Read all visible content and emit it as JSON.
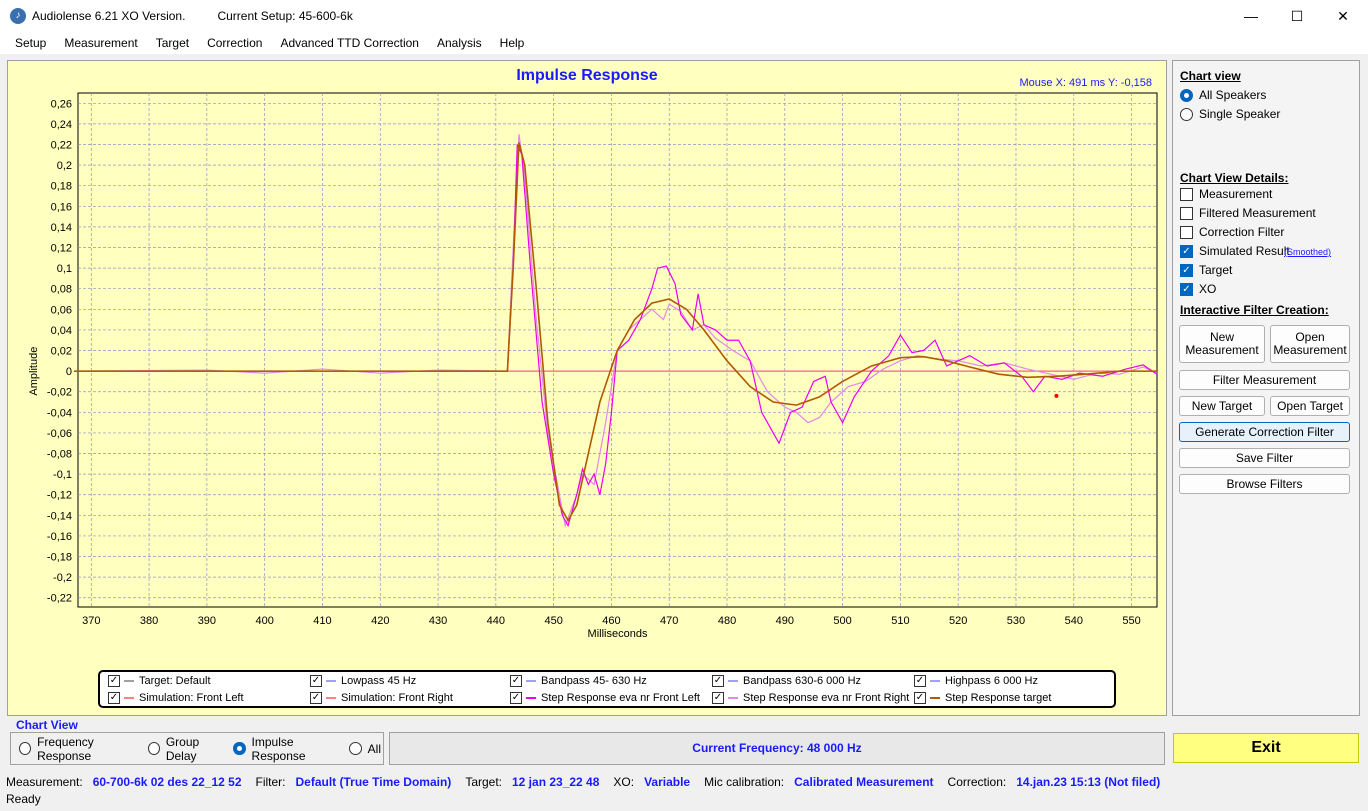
{
  "window": {
    "title": "Audiolense 6.21 XO Version.",
    "setup": "Current Setup: 45-600-6k",
    "min": "—",
    "max": "☐",
    "close": "✕"
  },
  "menu": [
    "Setup",
    "Measurement",
    "Target",
    "Correction",
    "Advanced TTD Correction",
    "Analysis",
    "Help"
  ],
  "chart": {
    "title": "Impulse Response",
    "mouse": "Mouse X: 491 ms   Y: -0,158"
  },
  "chart_data": {
    "type": "line",
    "title": "Impulse Response",
    "xlabel": "Milliseconds",
    "ylabel": "Amplitude",
    "xlim": [
      367.7,
      554.4
    ],
    "ylim": [
      -0.229,
      0.27
    ],
    "xticks": [
      370,
      380,
      390,
      400,
      410,
      420,
      430,
      440,
      450,
      460,
      470,
      480,
      490,
      500,
      510,
      520,
      530,
      540,
      550
    ],
    "yticks": [
      0.26,
      0.24,
      0.22,
      0.2,
      0.18,
      0.16,
      0.14,
      0.12,
      0.1,
      0.08,
      0.06,
      0.04,
      0.02,
      0,
      -0.02,
      -0.04,
      -0.06,
      -0.08,
      -0.1,
      -0.12,
      -0.14,
      -0.16,
      -0.18,
      -0.2,
      -0.22
    ],
    "ytick_labels": [
      "0,26",
      "0,24",
      "0,22",
      "0,2",
      "0,18",
      "0,16",
      "0,14",
      "0,12",
      "0,1",
      "0,08",
      "0,06",
      "0,04",
      "0,02",
      "0",
      "-0,02",
      "-0,04",
      "-0,06",
      "-0,08",
      "-0,1",
      "-0,12",
      "-0,14",
      "-0,16",
      "-0,18",
      "-0,2",
      "-0,22"
    ],
    "grid": true,
    "series": [
      {
        "name": "Step Response eva nr Front Right",
        "color": "#e08ae8",
        "points": [
          [
            367,
            0
          ],
          [
            390,
            0.001
          ],
          [
            400,
            -0.002
          ],
          [
            410,
            0.002
          ],
          [
            420,
            -0.002
          ],
          [
            430,
            0.001
          ],
          [
            442,
            0
          ],
          [
            443,
            0.12
          ],
          [
            444,
            0.23
          ],
          [
            445,
            0.19
          ],
          [
            447,
            0.05
          ],
          [
            449,
            -0.06
          ],
          [
            451,
            -0.12
          ],
          [
            452,
            -0.15
          ],
          [
            454,
            -0.12
          ],
          [
            455,
            -0.1
          ],
          [
            457,
            -0.11
          ],
          [
            459,
            -0.05
          ],
          [
            461,
            0.02
          ],
          [
            463,
            0.04
          ],
          [
            465,
            0.05
          ],
          [
            467,
            0.06
          ],
          [
            469,
            0.05
          ],
          [
            470,
            0.065
          ],
          [
            472,
            0.058
          ],
          [
            474,
            0.04
          ],
          [
            476,
            0.045
          ],
          [
            478,
            0.032
          ],
          [
            481,
            0.02
          ],
          [
            484,
            0.01
          ],
          [
            487,
            -0.02
          ],
          [
            490,
            -0.035
          ],
          [
            492,
            -0.04
          ],
          [
            494,
            -0.05
          ],
          [
            496,
            -0.045
          ],
          [
            498,
            -0.03
          ],
          [
            501,
            -0.015
          ],
          [
            504,
            -0.01
          ],
          [
            507,
            0.002
          ],
          [
            510,
            0.01
          ],
          [
            513,
            0.015
          ],
          [
            516,
            0.012
          ],
          [
            520,
            0.01
          ],
          [
            524,
            0.005
          ],
          [
            528,
            0.008
          ],
          [
            532,
            0.002
          ],
          [
            536,
            -0.003
          ],
          [
            540,
            -0.008
          ],
          [
            544,
            -0.002
          ],
          [
            548,
            -0.003
          ],
          [
            552,
            0.004
          ],
          [
            554.4,
            -0.002
          ]
        ]
      },
      {
        "name": "Step Response eva nr Front Left",
        "color": "#ee00ee",
        "points": [
          [
            367,
            0
          ],
          [
            442,
            0
          ],
          [
            443,
            0.1
          ],
          [
            443.7,
            0.22
          ],
          [
            444.5,
            0.21
          ],
          [
            446,
            0.1
          ],
          [
            448,
            -0.03
          ],
          [
            450,
            -0.1
          ],
          [
            451.5,
            -0.14
          ],
          [
            452.5,
            -0.15
          ],
          [
            454,
            -0.12
          ],
          [
            455,
            -0.095
          ],
          [
            456,
            -0.11
          ],
          [
            457,
            -0.1
          ],
          [
            458,
            -0.12
          ],
          [
            459,
            -0.09
          ],
          [
            460,
            -0.04
          ],
          [
            461,
            0.02
          ],
          [
            463,
            0.03
          ],
          [
            465,
            0.05
          ],
          [
            467,
            0.08
          ],
          [
            468,
            0.1
          ],
          [
            469.5,
            0.102
          ],
          [
            471,
            0.085
          ],
          [
            472,
            0.055
          ],
          [
            474,
            0.04
          ],
          [
            475,
            0.075
          ],
          [
            476,
            0.045
          ],
          [
            478,
            0.04
          ],
          [
            480,
            0.03
          ],
          [
            482,
            0.03
          ],
          [
            484,
            0.01
          ],
          [
            486,
            -0.04
          ],
          [
            488,
            -0.06
          ],
          [
            489,
            -0.07
          ],
          [
            491,
            -0.04
          ],
          [
            493,
            -0.035
          ],
          [
            495,
            -0.01
          ],
          [
            497,
            -0.005
          ],
          [
            498,
            -0.03
          ],
          [
            500,
            -0.05
          ],
          [
            502,
            -0.025
          ],
          [
            505,
            0.0
          ],
          [
            508,
            0.015
          ],
          [
            510,
            0.035
          ],
          [
            512,
            0.018
          ],
          [
            514,
            0.02
          ],
          [
            516,
            0.03
          ],
          [
            518,
            0.005
          ],
          [
            520,
            0.01
          ],
          [
            522,
            0.015
          ],
          [
            525,
            0.005
          ],
          [
            528,
            0.008
          ],
          [
            531,
            -0.005
          ],
          [
            533,
            -0.02
          ],
          [
            535,
            -0.005
          ],
          [
            538,
            -0.008
          ],
          [
            541,
            -0.002
          ],
          [
            545,
            -0.005
          ],
          [
            549,
            0.002
          ],
          [
            552,
            0.006
          ],
          [
            554.4,
            -0.003
          ]
        ]
      },
      {
        "name": "Step Response target",
        "color": "#b05a00",
        "points": [
          [
            367,
            0
          ],
          [
            442,
            0
          ],
          [
            443,
            0.1
          ],
          [
            444,
            0.222
          ],
          [
            445,
            0.2
          ],
          [
            447,
            0.08
          ],
          [
            449,
            -0.05
          ],
          [
            451,
            -0.13
          ],
          [
            452.5,
            -0.145
          ],
          [
            454,
            -0.13
          ],
          [
            456,
            -0.08
          ],
          [
            458,
            -0.03
          ],
          [
            461,
            0.02
          ],
          [
            464,
            0.05
          ],
          [
            467,
            0.066
          ],
          [
            470,
            0.07
          ],
          [
            473,
            0.06
          ],
          [
            476,
            0.04
          ],
          [
            480,
            0.01
          ],
          [
            484,
            -0.015
          ],
          [
            488,
            -0.03
          ],
          [
            492,
            -0.033
          ],
          [
            496,
            -0.025
          ],
          [
            500,
            -0.01
          ],
          [
            505,
            0.005
          ],
          [
            510,
            0.013
          ],
          [
            514,
            0.014
          ],
          [
            518,
            0.01
          ],
          [
            522,
            0.004
          ],
          [
            527,
            -0.003
          ],
          [
            532,
            -0.006
          ],
          [
            537,
            -0.005
          ],
          [
            542,
            -0.003
          ],
          [
            548,
            0
          ],
          [
            554.4,
            0
          ]
        ]
      }
    ],
    "zero_line_color": "#ff6080",
    "marker": {
      "x": 537,
      "y": -0.024,
      "color": "#ff0000"
    }
  },
  "legend": [
    {
      "label": "Target: Default",
      "color": "#a0a0a0"
    },
    {
      "label": "Lowpass  45 Hz",
      "color": "#a0a0ff"
    },
    {
      "label": "Bandpass   45- 630 Hz",
      "color": "#a0a0ff"
    },
    {
      "label": "Bandpass   630-6 000 Hz",
      "color": "#a0a0ff"
    },
    {
      "label": "Highpass  6 000 Hz",
      "color": "#a0a0ff"
    },
    {
      "label": "Simulation: Front Left",
      "color": "#ff8080"
    },
    {
      "label": "Simulation: Front Right",
      "color": "#ff8080"
    },
    {
      "label": "Step Response eva nr Front Left",
      "color": "#ee00ee"
    },
    {
      "label": "Step Response eva nr Front Right",
      "color": "#e08ae8"
    },
    {
      "label": "Step Response target",
      "color": "#b05a00"
    }
  ],
  "side": {
    "chart_view": "Chart view",
    "all": "All Speakers",
    "single": "Single Speaker",
    "details": "Chart View Details:",
    "checks": [
      {
        "label": "Measurement",
        "on": false
      },
      {
        "label": "Filtered Measurement",
        "on": false
      },
      {
        "label": "Correction Filter",
        "on": false
      },
      {
        "label": "Simulated Result",
        "on": true
      },
      {
        "label": "Target",
        "on": true
      },
      {
        "label": "XO",
        "on": true
      }
    ],
    "smoothed": "(Smoothed)",
    "ifc": "Interactive Filter Creation:",
    "new_meas": "New Measurement",
    "open_meas": "Open Measurement",
    "filter_meas": "Filter Measurement",
    "new_target": "New Target",
    "open_target": "Open Target",
    "gen": "Generate Correction Filter",
    "save": "Save Filter",
    "browse": "Browse Filters"
  },
  "bottom": {
    "chart_view": "Chart View",
    "opts": [
      "Frequency Response",
      "Group Delay",
      "Impulse Response",
      "All"
    ],
    "selected": 2,
    "freq": "Current Frequency: 48 000 Hz",
    "exit": "Exit"
  },
  "status": [
    {
      "k": "Measurement:",
      "v": "60-700-6k 02 des 22_12 52"
    },
    {
      "k": "Filter:",
      "v": "Default (True Time Domain)"
    },
    {
      "k": "Target:",
      "v": "12 jan 23_22 48"
    },
    {
      "k": "XO:",
      "v": "Variable"
    },
    {
      "k": "Mic calibration:",
      "v": "Calibrated Measurement"
    },
    {
      "k": "Correction:",
      "v": "14.jan.23 15:13 (Not filed)"
    }
  ],
  "ready": "Ready"
}
